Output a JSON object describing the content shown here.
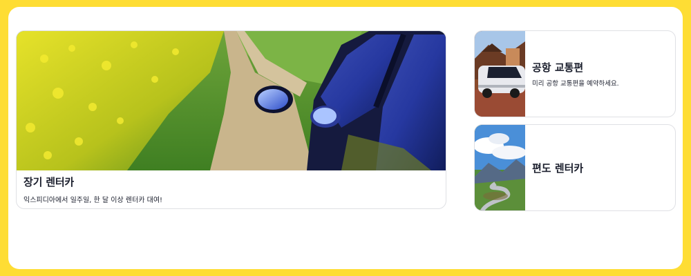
{
  "colors": {
    "frame": "#fedd34",
    "card_border": "#dfe0e4",
    "text": "#1b1f2d"
  },
  "cards": {
    "long_term": {
      "title": "장기 렌터카",
      "description": "익스피디아에서 일주일, 한 달 이상 렌터카 대여!",
      "image": "rapeseed-field-car-mirror-photo"
    },
    "airport": {
      "title": "공항 교통편",
      "description": "미리 공항 교통편을 예약하세요.",
      "image": "airport-van-photo"
    },
    "one_way": {
      "title": "편도 렌터카",
      "image": "mountain-road-photo"
    }
  }
}
